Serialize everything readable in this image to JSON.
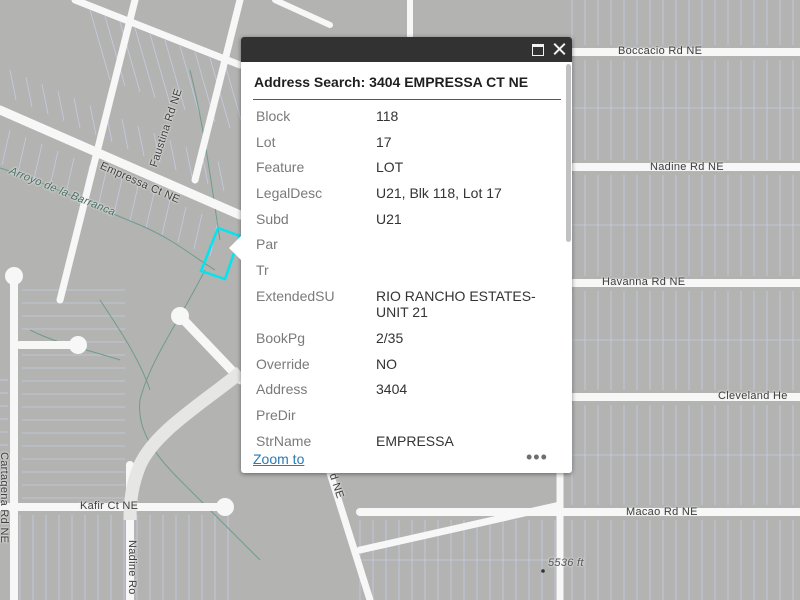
{
  "map": {
    "street_labels": [
      {
        "id": "boccacio",
        "text": "Boccacio Rd NE"
      },
      {
        "id": "nadine-e",
        "text": "Nadine Rd NE"
      },
      {
        "id": "havanna",
        "text": "Havanna Rd NE"
      },
      {
        "id": "cleveland",
        "text": "Cleveland He"
      },
      {
        "id": "macao",
        "text": "Macao Rd NE"
      },
      {
        "id": "kafir",
        "text": "Kafir Ct NE"
      },
      {
        "id": "cartagena",
        "text": "Cartagena Rd NE"
      },
      {
        "id": "nadine-s",
        "text": "Nadine Ro"
      },
      {
        "id": "empressa",
        "text": "Empressa Ct NE"
      },
      {
        "id": "faustina",
        "text": "Faustina Rd NE"
      },
      {
        "id": "arroyo",
        "text": "Arroyo de la Barranca"
      },
      {
        "id": "road-ne",
        "text": "d NE"
      }
    ],
    "elevation_label": "5536 ft",
    "colors": {
      "background": "#b3b3b1",
      "road": "#f7f7f7",
      "parcel": "#c4cbe5",
      "selection": "#00e5f0",
      "stream": "#6f9c8e"
    }
  },
  "popup": {
    "title": "Address Search: 3404 EMPRESSA CT NE",
    "fields": [
      {
        "key": "Block",
        "value": "118"
      },
      {
        "key": "Lot",
        "value": "17"
      },
      {
        "key": "Feature",
        "value": "LOT"
      },
      {
        "key": "LegalDesc",
        "value": "U21, Blk 118, Lot 17"
      },
      {
        "key": "Subd",
        "value": "U21"
      },
      {
        "key": "Par",
        "value": ""
      },
      {
        "key": "Tr",
        "value": ""
      },
      {
        "key": "ExtendedSU",
        "value": "RIO RANCHO ESTATES-UNIT 21"
      },
      {
        "key": "BookPg",
        "value": "2/35"
      },
      {
        "key": "Override",
        "value": "NO"
      },
      {
        "key": "Address",
        "value": "3404"
      },
      {
        "key": "PreDir",
        "value": ""
      },
      {
        "key": "StrName",
        "value": "EMPRESSA"
      }
    ],
    "zoom_label": "Zoom to",
    "more_label": "•••",
    "icons": {
      "maximize": "maximize-icon",
      "close": "close-icon",
      "more": "ellipsis-icon"
    }
  }
}
